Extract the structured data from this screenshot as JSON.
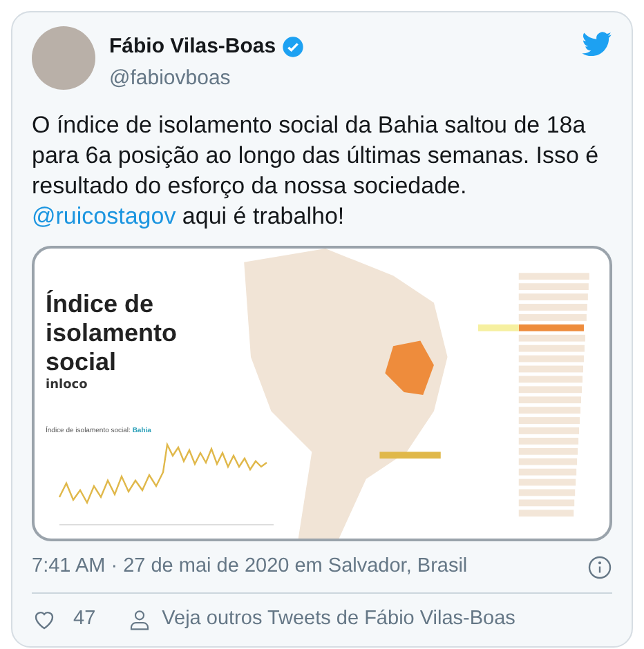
{
  "author": {
    "name": "Fábio Vilas-Boas",
    "handle": "@fabiovboas",
    "verified": true
  },
  "tweet": {
    "text": "O índice de isolamento social da Bahia saltou de 18a para 6a posição ao longo das últimas semanas. Isso é resultado do esforço da nossa sociedade. ",
    "mention": "@ruicostagov",
    "text_after": " aqui é trabalho!"
  },
  "media": {
    "title": "Índice de isolamento social",
    "subtitle": "inloco",
    "chart_label": "Índice de isolamento social: ",
    "chart_state": "Bahia"
  },
  "meta": {
    "time": "7:41 AM · 27 de mai de 2020 em Salvador, Brasil"
  },
  "actions": {
    "likes": "47",
    "more": "Veja outros Tweets de Fábio Vilas-Boas"
  }
}
